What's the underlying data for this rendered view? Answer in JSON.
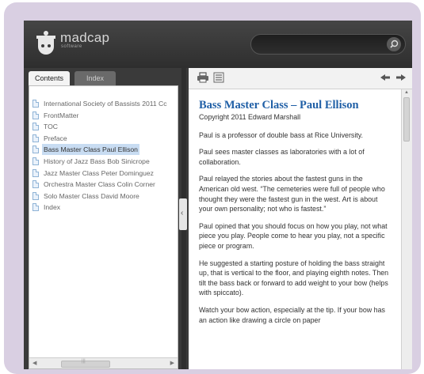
{
  "app": {
    "logo_text": "madcap",
    "logo_sub": "software"
  },
  "search": {
    "placeholder": ""
  },
  "tabs": {
    "contents": "Contents",
    "index": "Index"
  },
  "toc": {
    "items": [
      "International Society of Bassists 2011 Cc",
      "FrontMatter",
      "TOC",
      "Preface",
      "Bass Master Class Paul Ellison",
      "History of Jazz Bass Bob Sinicrope",
      "Jazz Master Class Peter Dominguez",
      "Orchestra Master Class Colin Corner",
      "Solo Master Class David Moore",
      "Index"
    ],
    "selected_index": 4
  },
  "toolbar": {
    "print_icon": "printer-icon",
    "toc_icon": "list-icon",
    "back_icon": "back-arrow-icon",
    "forward_icon": "forward-arrow-icon"
  },
  "article": {
    "title": "Bass Master Class – Paul Ellison",
    "copyright": "Copyright 2011 Edward Marshall",
    "paragraphs": [
      "Paul is a professor of double bass at Rice University.",
      "Paul sees master classes as laboratories with a lot of collaboration.",
      "Paul relayed the stories about the fastest guns in the American old west. “The cemeteries were full of people who thought they were the fastest gun in the west. Art is about your own personality; not who is fastest.”",
      "Paul opined that you should focus on how you play, not what piece you play. People come to hear you play, not a specific piece or program.",
      "He suggested a starting posture of holding the bass straight up, that is vertical to the floor, and playing eighth notes. Then tilt the bass back or forward to add weight to your bow (helps with spiccato).",
      "Watch your bow action, especially at the tip. If your bow has an action like drawing a circle on paper"
    ]
  },
  "colors": {
    "frame": "#d9cfe2",
    "header": "#3a3a3a",
    "title": "#1f5fa6",
    "selection": "#c8dcf2"
  }
}
